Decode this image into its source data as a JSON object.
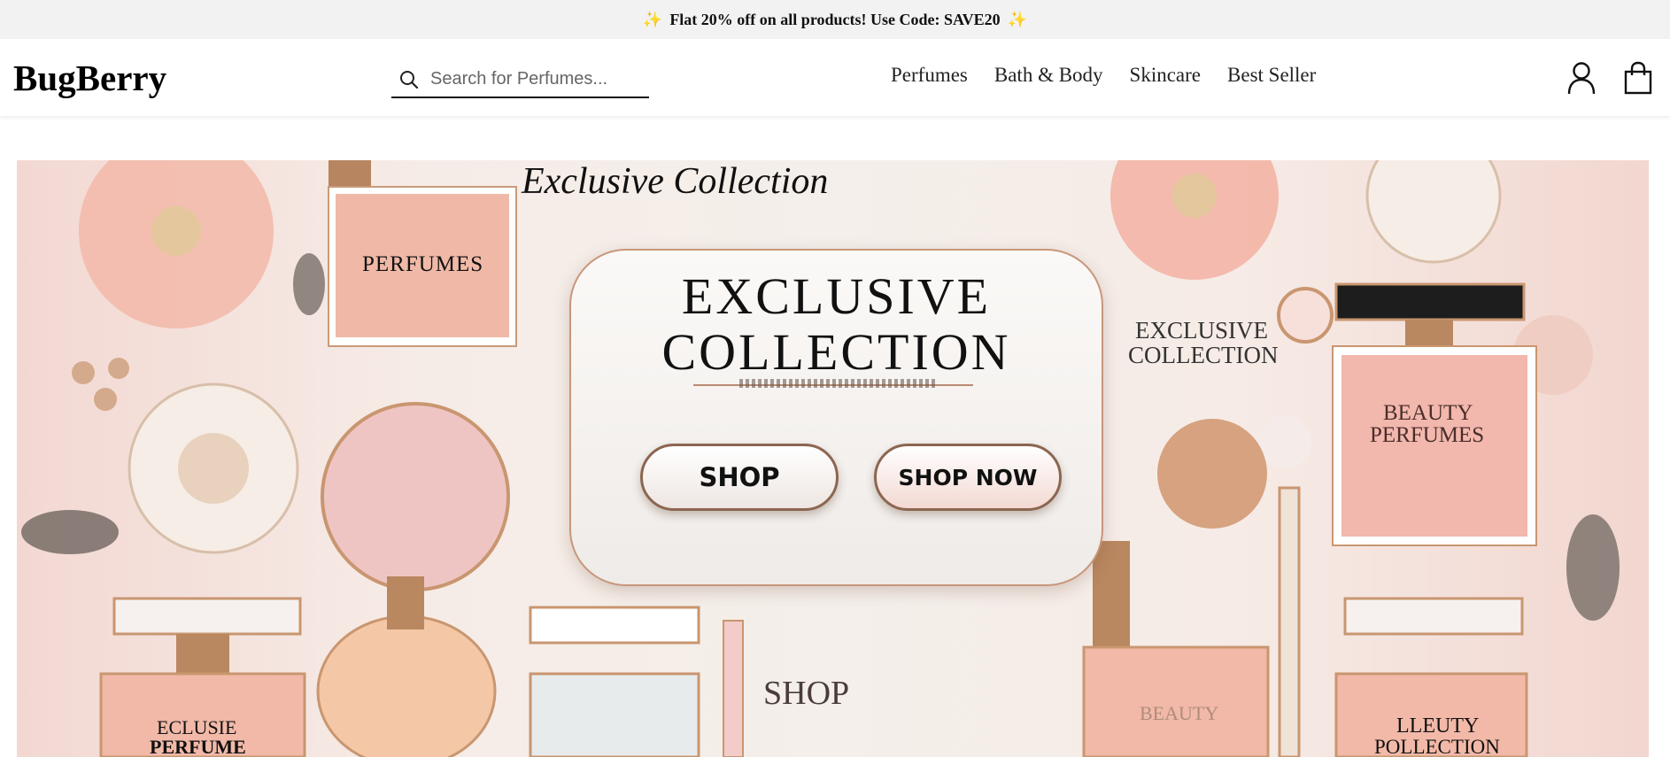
{
  "promo": {
    "spark_left": "✨",
    "text": "Flat 20% off on all products! Use Code: SAVE20",
    "spark_right": "✨"
  },
  "header": {
    "logo": "BugBerry",
    "search": {
      "placeholder": "Search for Perfumes..."
    },
    "nav": [
      "Perfumes",
      "Bath & Body",
      "Skincare",
      "Best Seller"
    ],
    "icons": [
      "user-icon",
      "shopping-bag-icon"
    ]
  },
  "hero": {
    "script_title": "Exclusive Collection",
    "card_title_1": "EXCLUSIVE",
    "card_title_2": "COLLECTION",
    "buttons": [
      "SHOP",
      "SHOP NOW"
    ],
    "side_label_1": "EXCLUSIVE",
    "side_label_2": "COLLECTION",
    "bottle_labels": {
      "perfumes": "PERFUMES",
      "beauty_1": "BEAUTY",
      "beauty_2": "PERFUMES",
      "bottom_shop": "SHOP",
      "bottom_beauty": "BEAUTY",
      "bottom_left_1": "ECLUSIE",
      "bottom_left_2": "PERFUME",
      "bottom_right_1": "LLEUTY",
      "bottom_right_2": "POLLECTION"
    }
  },
  "colors": {
    "promo_bg": "#f2f2f2",
    "accent_gold": "#b98a72",
    "blush": "#f3d8d2"
  }
}
